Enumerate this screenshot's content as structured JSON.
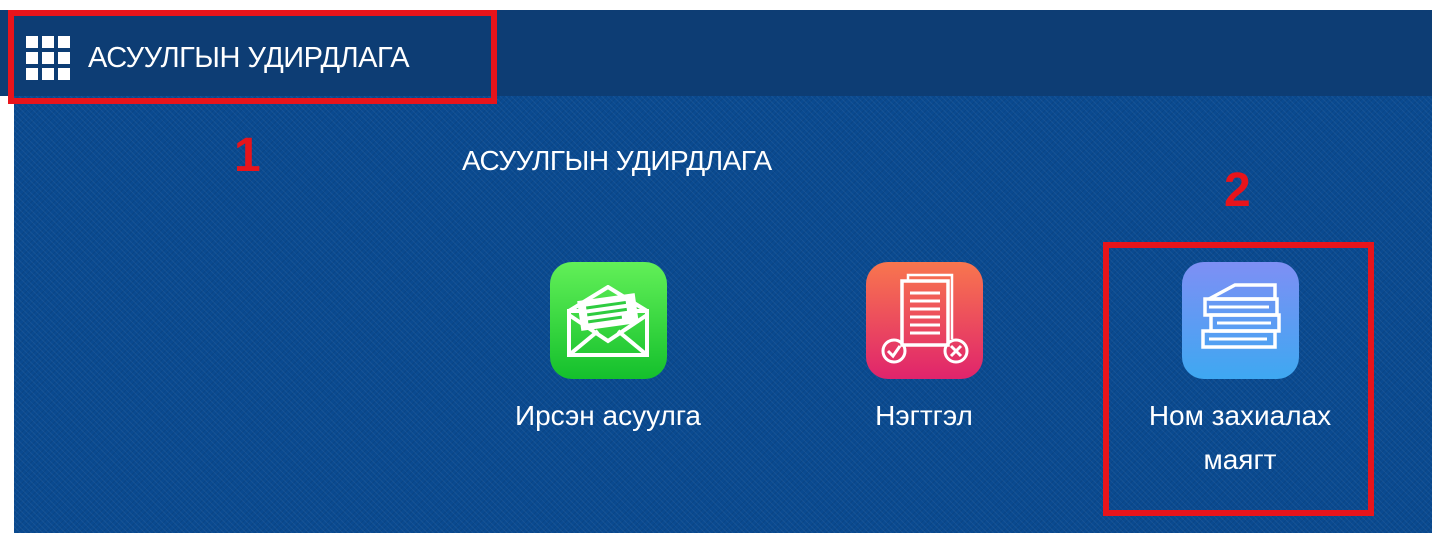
{
  "header": {
    "title": "АСУУЛГЫН УДИРДЛАГА",
    "menu_icon": "grid-menu-icon"
  },
  "section": {
    "title": "АСУУЛГЫН УДИРДЛАГА"
  },
  "tiles": [
    {
      "label": "Ирсэн асуулга",
      "icon": "envelope-icon",
      "color": "#2ecc40"
    },
    {
      "label": "Нэгтгэл",
      "icon": "document-report-icon",
      "color": "#f0506e"
    },
    {
      "label": "Ном захиалах маягт",
      "icon": "books-icon",
      "color": "#5b9bf0"
    }
  ],
  "annotations": [
    {
      "number": "1",
      "color": "#e8141b"
    },
    {
      "number": "2",
      "color": "#e8141b"
    }
  ]
}
